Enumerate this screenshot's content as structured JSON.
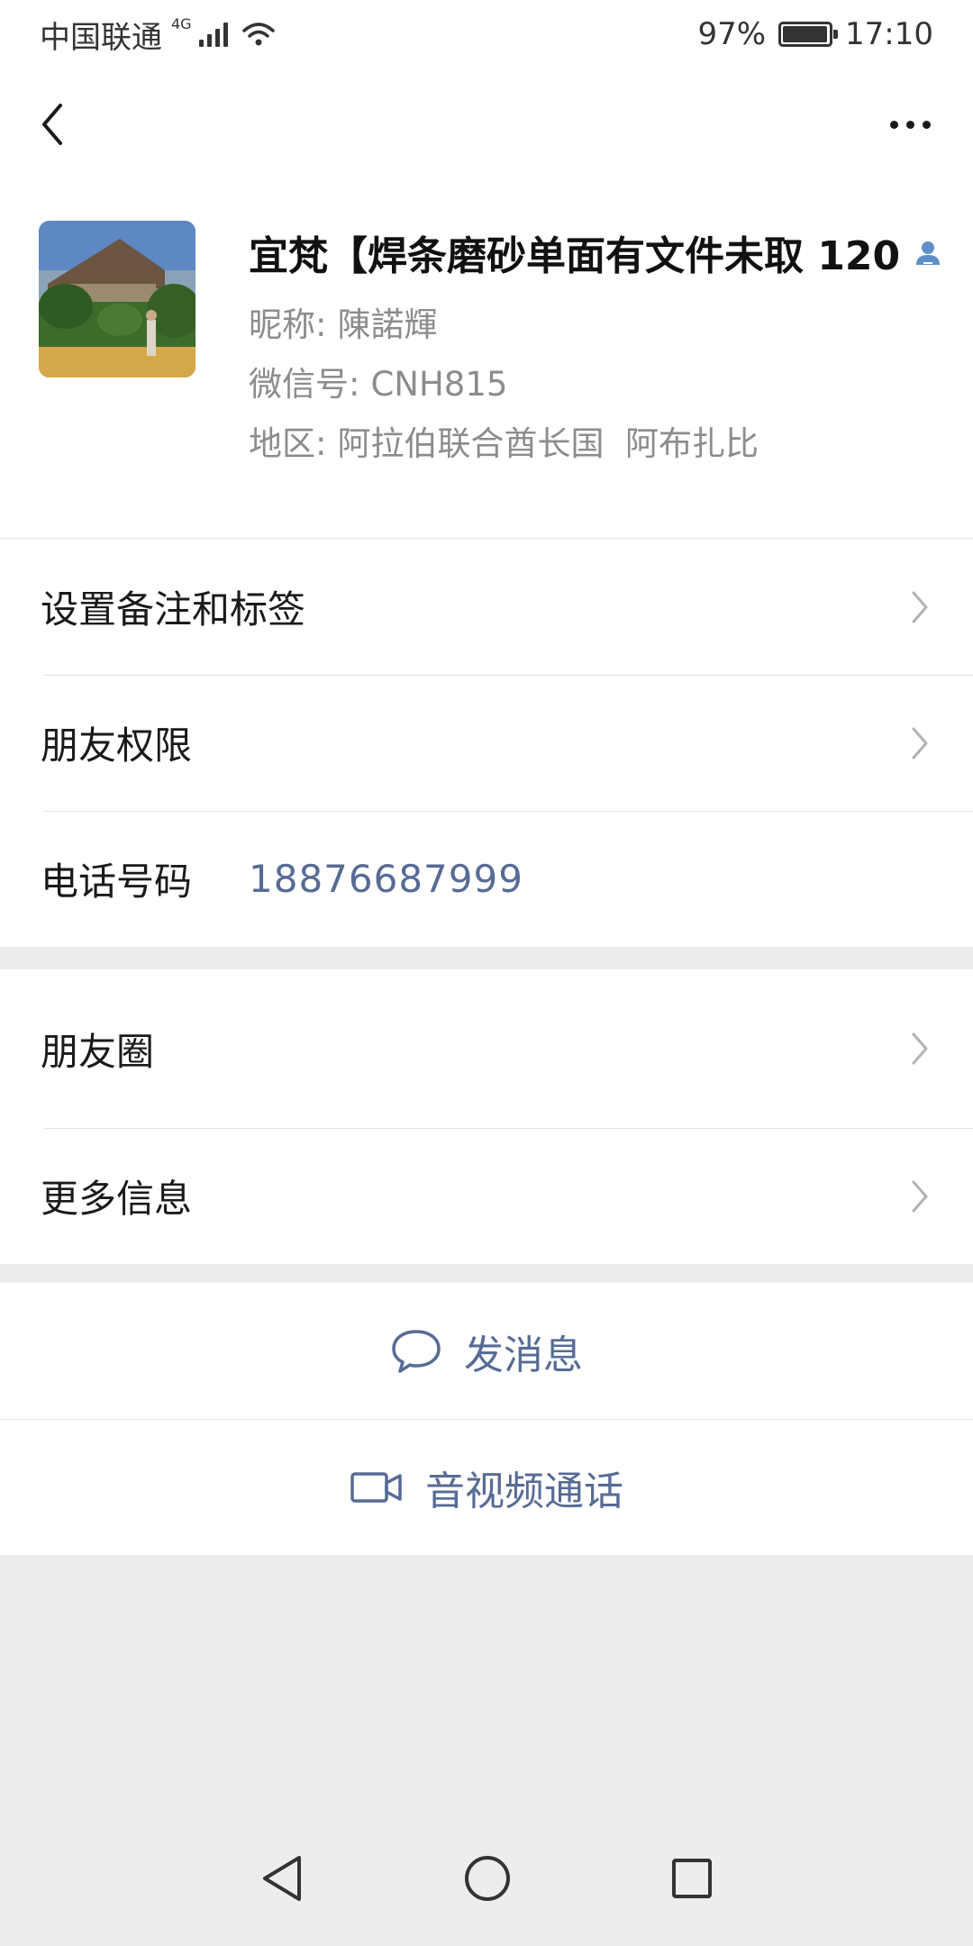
{
  "status_bar": {
    "carrier": "中国联通",
    "network": "4G",
    "battery_percent": "97%",
    "battery_level": 0.97,
    "time": "17:10"
  },
  "header": {
    "back_icon": "chevron-left-icon",
    "more_icon": "more-dots-icon"
  },
  "profile": {
    "display_name": "宜梵【焊条磨砂单面有文件未取 120",
    "nickname_label": "昵称:",
    "nickname": "陳諾輝",
    "wechat_id_label": "微信号:",
    "wechat_id": "CNH815",
    "region_label": "地区:",
    "region": "阿拉伯联合酋长国  阿布扎比"
  },
  "settings": {
    "remark_tags": "设置备注和标签",
    "friend_permissions": "朋友权限",
    "phone_label": "电话号码",
    "phone_value": "18876687999"
  },
  "more": {
    "moments": "朋友圈",
    "more_info": "更多信息"
  },
  "actions": {
    "send_message": "发消息",
    "video_call": "音视频通话"
  },
  "colors": {
    "link_blue": "#576b95",
    "background": "#ededed",
    "card": "#ffffff"
  }
}
